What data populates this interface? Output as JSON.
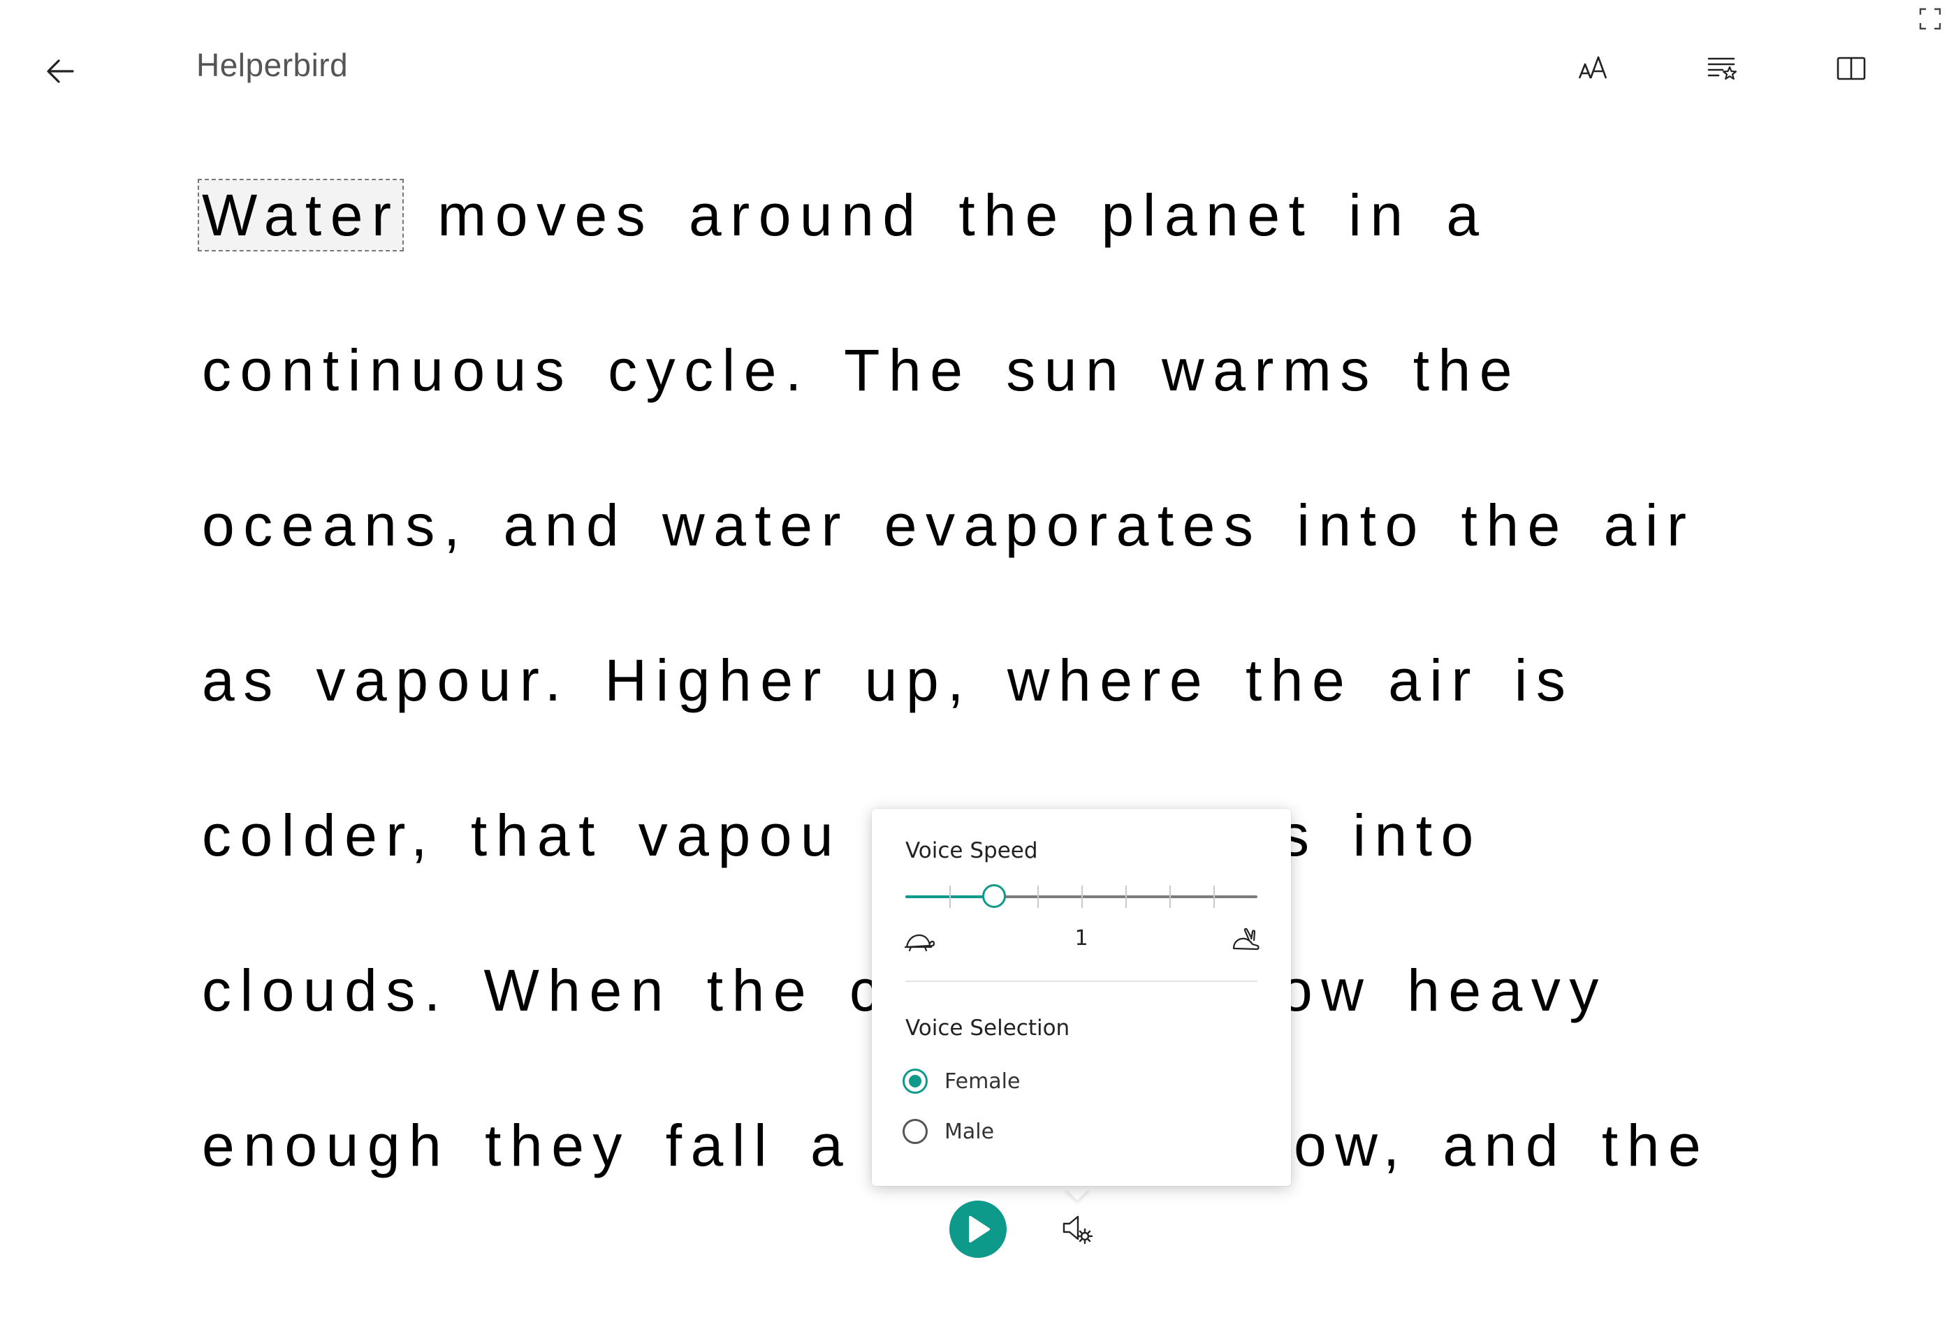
{
  "header": {
    "title": "Helperbird"
  },
  "icons": {
    "back": "arrow-left-icon",
    "text_size": "text-size-icon",
    "reading_preferences": "text-preferences-icon",
    "column_view": "columns-icon",
    "fullscreen": "fullscreen-icon",
    "slow_speed": "turtle-icon",
    "fast_speed": "rabbit-icon",
    "play": "play-icon",
    "voice_settings": "speaker-settings-icon"
  },
  "reading": {
    "current_word": "Water",
    "lines": [
      "moves around the planet in a",
      "continuous cycle. The sun warms the",
      "oceans, and water evaporates into the air",
      "as vapour. Higher up, where the air is",
      "colder, that vapou",
      "clouds. When the c",
      "enough they fall a"
    ],
    "line_tails": [
      "",
      "",
      "",
      "",
      "s into",
      "ow heavy",
      "ow, and the"
    ]
  },
  "voice_panel": {
    "speed_heading": "Voice Speed",
    "speed_value": "1",
    "speed_fraction": 0.25,
    "tick_count": 9,
    "selection_heading": "Voice Selection",
    "options": [
      {
        "label": "Female",
        "selected": true
      },
      {
        "label": "Male",
        "selected": false
      }
    ]
  },
  "colors": {
    "accent": "#0e9a8a",
    "text": "#000000",
    "title": "#555555"
  }
}
